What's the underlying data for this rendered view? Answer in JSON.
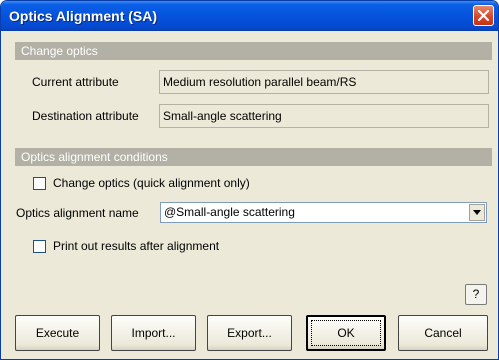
{
  "window": {
    "title": "Optics Alignment (SA)"
  },
  "change_optics": {
    "header": "Change optics",
    "current_label": "Current attribute",
    "current_value": "Medium resolution parallel beam/RS",
    "destination_label": "Destination attribute",
    "destination_value": "Small-angle scattering"
  },
  "conditions": {
    "header": "Optics alignment conditions",
    "quick_alignment_label": "Change optics (quick alignment only)",
    "quick_alignment_checked": false,
    "alignment_name_label": "Optics alignment name",
    "alignment_name_value": "@Small-angle scattering",
    "print_results_label": "Print out results after alignment",
    "print_results_checked": false
  },
  "help_label": "?",
  "buttons": {
    "execute": "Execute",
    "import": "Import...",
    "export": "Export...",
    "ok": "OK",
    "cancel": "Cancel"
  },
  "icons": {
    "close": "close-icon",
    "dropdown": "chevron-down-icon"
  },
  "colors": {
    "title_bar": "#0553dd",
    "section_header": "#b3b1a6",
    "dialog_bg": "#ece9d8",
    "close_button": "#d6472a"
  }
}
